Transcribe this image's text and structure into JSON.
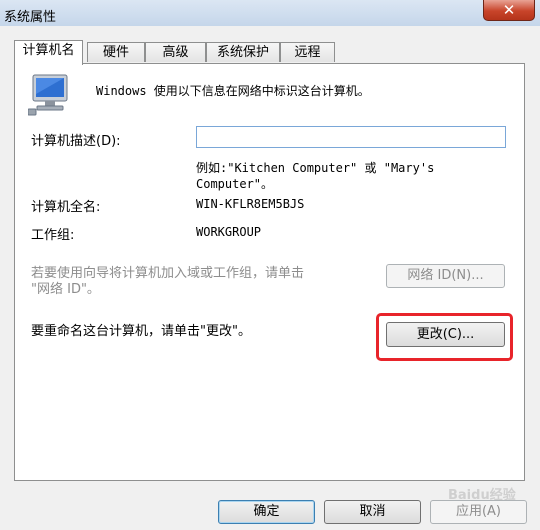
{
  "window": {
    "title": "系统属性",
    "close_glyph": "✕"
  },
  "tabs": [
    {
      "label": "计算机名",
      "active": true
    },
    {
      "label": "硬件",
      "active": false
    },
    {
      "label": "高级",
      "active": false
    },
    {
      "label": "系统保护",
      "active": false
    },
    {
      "label": "远程",
      "active": false
    }
  ],
  "computer_name": {
    "intro": "Windows 使用以下信息在网络中标识这台计算机。",
    "description_label": "计算机描述(D):",
    "description_value": "",
    "example_line1": "例如:\"Kitchen Computer\" 或 \"Mary's",
    "example_line2": "Computer\"。",
    "full_name_label": "计算机全名:",
    "full_name_value": "WIN-KFLR8EM5BJS",
    "workgroup_label": "工作组:",
    "workgroup_value": "WORKGROUP",
    "network_id_text_line1": "若要使用向导将计算机加入域或工作组，请单击",
    "network_id_text_line2": "\"网络 ID\"。",
    "network_id_button": "网络 ID(N)...",
    "rename_text": "要重命名这台计算机，请单击\"更改\"。",
    "change_button": "更改(C)..."
  },
  "footer": {
    "ok": "确定",
    "cancel": "取消",
    "apply": "应用(A)"
  },
  "watermark": "Baidu经验",
  "colors": {
    "highlight": "#e8242a",
    "titlebar": "#c5d6ea",
    "close": "#c8442a"
  },
  "icons": {
    "computer": "computer-monitor-icon",
    "close": "close-icon"
  }
}
